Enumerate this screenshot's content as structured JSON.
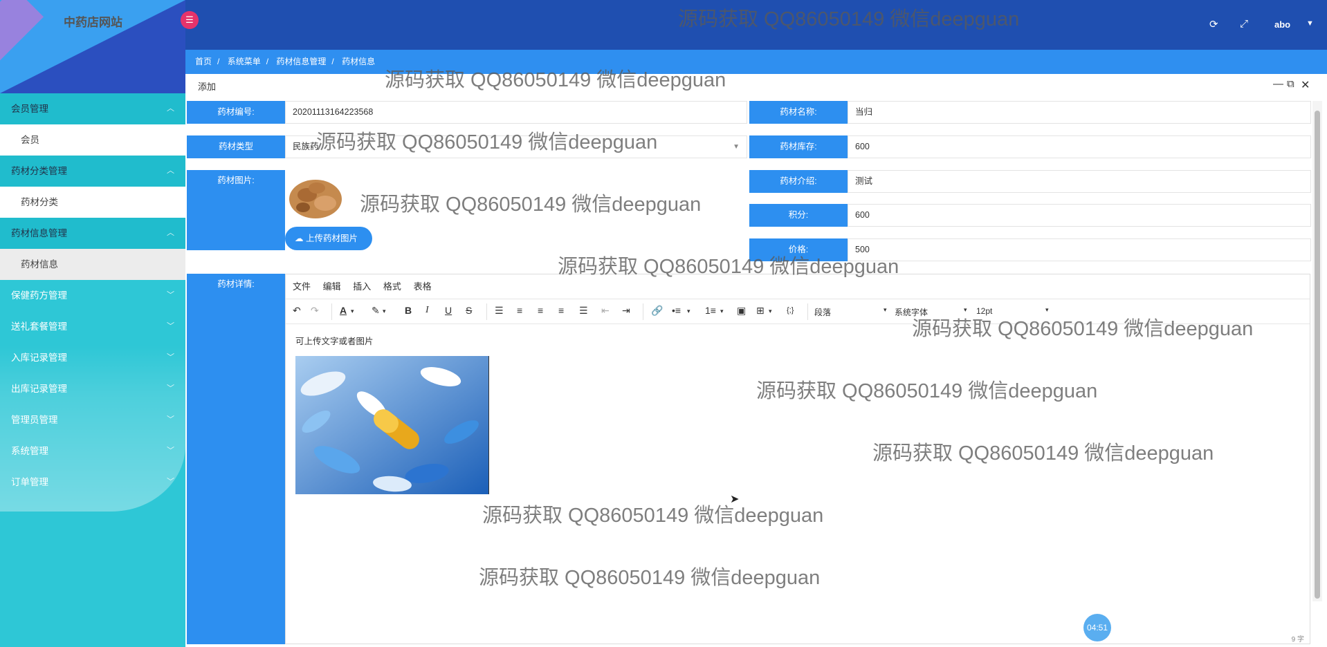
{
  "app": {
    "site_title": "中药店网站"
  },
  "topbar": {
    "user": "abo"
  },
  "breadcrumb": [
    "首页",
    "系统菜单",
    "药材信息管理",
    "药材信息"
  ],
  "sidebar": {
    "menu": [
      {
        "label": "会员管理",
        "open": true,
        "sub": [
          {
            "label": "会员"
          }
        ]
      },
      {
        "label": "药材分类管理",
        "open": true,
        "sub": [
          {
            "label": "药材分类"
          }
        ]
      },
      {
        "label": "药材信息管理",
        "open": true,
        "sub": [
          {
            "label": "药材信息",
            "active": true
          }
        ]
      },
      {
        "label": "保健药方管理"
      },
      {
        "label": "送礼套餐管理"
      },
      {
        "label": "入库记录管理"
      },
      {
        "label": "出库记录管理"
      },
      {
        "label": "管理员管理"
      },
      {
        "label": "系统管理"
      },
      {
        "label": "订单管理"
      }
    ]
  },
  "dialog": {
    "title": "添加"
  },
  "form": {
    "code_label": "药材编号:",
    "code_value": "20201113164223568",
    "name_label": "药材名称:",
    "name_value": "当归",
    "type_label": "药材类型",
    "type_value": "民族药",
    "stock_label": "药材库存:",
    "stock_value": "600",
    "image_label": "药材图片:",
    "intro_label": "药材介绍:",
    "intro_value": "测试",
    "points_label": "积分:",
    "points_value": "600",
    "price_label": "价格:",
    "price_value": "500",
    "upload_button": "上传药材图片",
    "detail_label": "药材详情:"
  },
  "editor": {
    "menubar": [
      "文件",
      "编辑",
      "插入",
      "格式",
      "表格"
    ],
    "block_format": "段落",
    "font_family": "系统字体",
    "font_size": "12pt",
    "content_text": "可上传文字或者图片",
    "word_count": "9 字"
  },
  "timer": "04:51",
  "watermark": "源码获取 QQ86050149 微信deepguan",
  "colors": {
    "sidebar": "#2ec7d6",
    "topbar": "#1f4fb0",
    "label_bg": "#2d8ff0",
    "accent": "#e5336b"
  }
}
